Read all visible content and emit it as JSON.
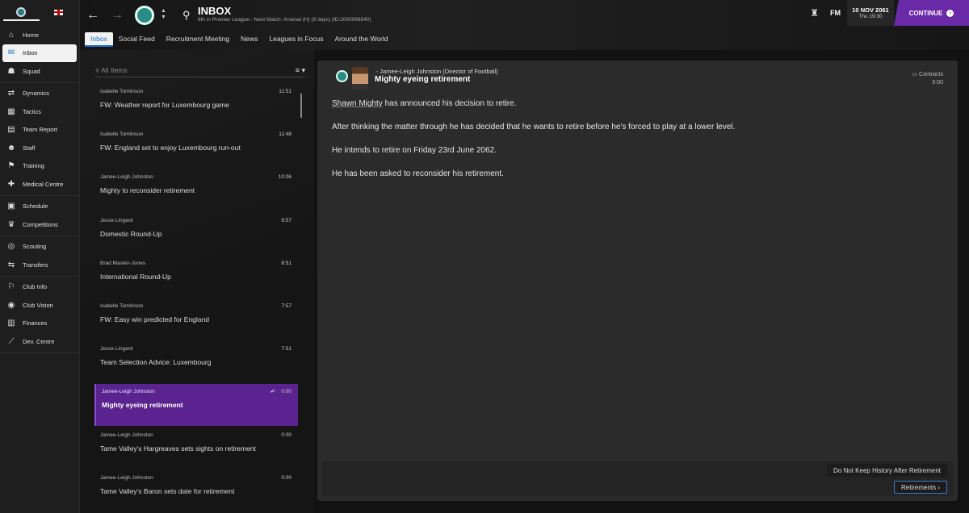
{
  "sidebar": {
    "items": [
      {
        "label": "Home",
        "icon": "home-icon",
        "glyph": "⌂"
      },
      {
        "label": "Inbox",
        "icon": "inbox-icon",
        "glyph": "✉"
      },
      {
        "label": "Squad",
        "icon": "squad-icon",
        "glyph": "☗"
      },
      {
        "label": "Dynamics",
        "icon": "dynamics-icon",
        "glyph": "⇄"
      },
      {
        "label": "Tactics",
        "icon": "tactics-icon",
        "glyph": "▦"
      },
      {
        "label": "Team Report",
        "icon": "report-icon",
        "glyph": "▤"
      },
      {
        "label": "Staff",
        "icon": "staff-icon",
        "glyph": "☻"
      },
      {
        "label": "Training",
        "icon": "training-icon",
        "glyph": "⚑"
      },
      {
        "label": "Medical Centre",
        "icon": "medical-icon",
        "glyph": "✚"
      },
      {
        "label": "Schedule",
        "icon": "schedule-icon",
        "glyph": "▣"
      },
      {
        "label": "Competitions",
        "icon": "trophy-icon",
        "glyph": "♛"
      },
      {
        "label": "Scouting",
        "icon": "scouting-icon",
        "glyph": "◎"
      },
      {
        "label": "Transfers",
        "icon": "transfers-icon",
        "glyph": "⇆"
      },
      {
        "label": "Club Info",
        "icon": "club-info-icon",
        "glyph": "⚐"
      },
      {
        "label": "Club Vision",
        "icon": "vision-icon",
        "glyph": "◉"
      },
      {
        "label": "Finances",
        "icon": "finances-icon",
        "glyph": "▥"
      },
      {
        "label": "Dev. Centre",
        "icon": "dev-centre-icon",
        "glyph": "⟋"
      }
    ]
  },
  "header": {
    "title": "INBOX",
    "subtitle": "6th in Premier League - Next Match: Arsenal (H) (9 days) (ID:2000096540)",
    "tabs": [
      "Inbox",
      "Social Feed",
      "Recruitment Meeting",
      "News",
      "Leagues in Focus",
      "Around the World"
    ],
    "fm_label": "FM",
    "date": "10 NOV 2061",
    "time": "Thu 19:30",
    "continue_label": "CONTINUE"
  },
  "list": {
    "search_placeholder": "All Items",
    "messages": [
      {
        "from": "Isabelle Tomlinson",
        "time": "11:51",
        "subject": "FW: Weather report for Luxembourg game"
      },
      {
        "from": "Isabelle Tomlinson",
        "time": "11:48",
        "subject": "FW: England set to enjoy Luxembourg run-out"
      },
      {
        "from": "Jamee-Leigh Johnston",
        "time": "10:06",
        "subject": "Mighty to reconsider retirement"
      },
      {
        "from": "Jesse Lingard",
        "time": "8:57",
        "subject": "Domestic Round-Up"
      },
      {
        "from": "Brad Maslen-Jones",
        "time": "8:51",
        "subject": "International Round-Up"
      },
      {
        "from": "Isabelle Tomlinson",
        "time": "7:57",
        "subject": "FW: Easy win predicted for England"
      },
      {
        "from": "Jesse Lingard",
        "time": "7:51",
        "subject": "Team Selection Advice: Luxembourg"
      },
      {
        "from": "Jamee-Leigh Johnston",
        "time": "0:00",
        "subject": "Mighty eyeing retirement"
      },
      {
        "from": "Jamee-Leigh Johnston",
        "time": "0:00",
        "subject": "Tame Valley's Hargreaves sets sights on retirement"
      },
      {
        "from": "Jamee-Leigh Johnston",
        "time": "0:00",
        "subject": "Tame Valley's Baron sets date for retirement"
      }
    ]
  },
  "message": {
    "sender": "Jamee-Leigh Johnston",
    "sender_role": "(Director of Football)",
    "subject": "Mighty eyeing retirement",
    "category": "Contracts",
    "time": "0:00",
    "player_name": "Shawn Mighty",
    "line1_rest": " has announced his decision to retire.",
    "line2": "After thinking the matter through he has decided that he wants to retire before he's forced to play at a lower level.",
    "line3": "He intends to retire on Friday 23rd June 2062.",
    "line4": "He has been asked to reconsider his retirement.",
    "option_label": "Do Not Keep History After Retirement",
    "retirements_label": "Retirements"
  },
  "colors": {
    "accent": "#6a2aa8",
    "selected_row": "#5a2390",
    "active_tab_text": "#1a6fd1"
  }
}
